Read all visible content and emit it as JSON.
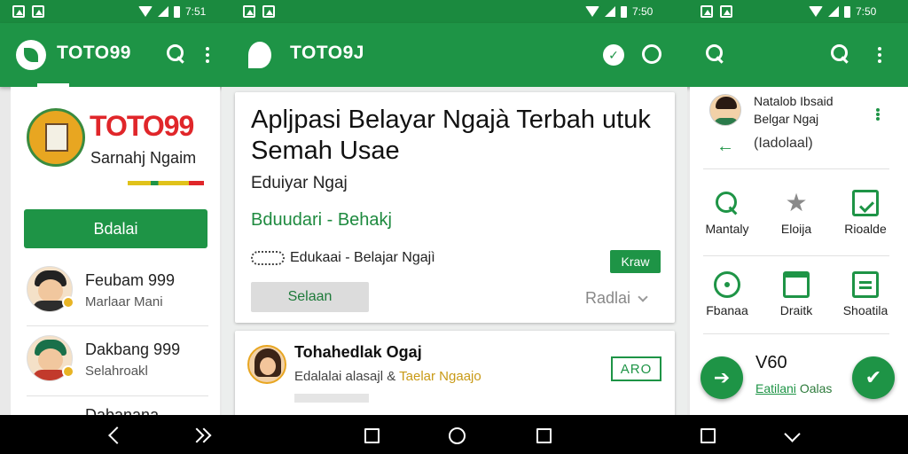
{
  "statusbar": {
    "times": [
      "7:51",
      "7:50",
      "7:50"
    ]
  },
  "appbar": {
    "left_title": "TOTO99",
    "center_title": "TOTO9J"
  },
  "panel_left": {
    "brand_title": "TOTO99",
    "brand_subtitle": "Sarnahj Ngaim",
    "button_label": "Bdalai",
    "items": [
      {
        "title": "Feubam 999",
        "subtitle": "Marlaar Mani"
      },
      {
        "title": "Dakbang 999",
        "subtitle": "Selahroakl"
      },
      {
        "title": "Dabanana",
        "subtitle": ""
      }
    ]
  },
  "card_main": {
    "title": "Apljpasi Belayar Ngajà Terbah utuk Semah Usae",
    "subtitle": "Eduiyar Ngaj",
    "green_text": "Bduudari - Behakj",
    "row_text": "Edukaai - Belajar Ngajì",
    "pill_label": "Kraw",
    "button_label": "Selaan",
    "more_label": "Radlai"
  },
  "card_second": {
    "title": "Tohahedlak Ogaj",
    "subtitle_plain": "Edalalai alasajl &",
    "subtitle_gold": "Taelar Ngaajo",
    "code_label": "ARO"
  },
  "panel_right": {
    "name_line1": "Natalob Ibsaid",
    "name_line2": "Belgar Ngaj",
    "back_label": "(Iadolaal)",
    "grid": [
      {
        "label": "Mantaly",
        "icon": "search-icon"
      },
      {
        "label": "Eloija",
        "icon": "star-icon"
      },
      {
        "label": "Rioalde",
        "icon": "check-box-icon"
      },
      {
        "label": "Fbanaa",
        "icon": "target-icon"
      },
      {
        "label": "Draitk",
        "icon": "calendar-icon"
      },
      {
        "label": "Shoatila",
        "icon": "document-icon"
      }
    ],
    "version": "V60",
    "footer_green": "Eatilani",
    "footer_muted": "Oalas"
  },
  "colors": {
    "primary": "#1e9446",
    "status": "#1b8a3f",
    "brand_red": "#e0262a",
    "gold": "#c99a16"
  }
}
